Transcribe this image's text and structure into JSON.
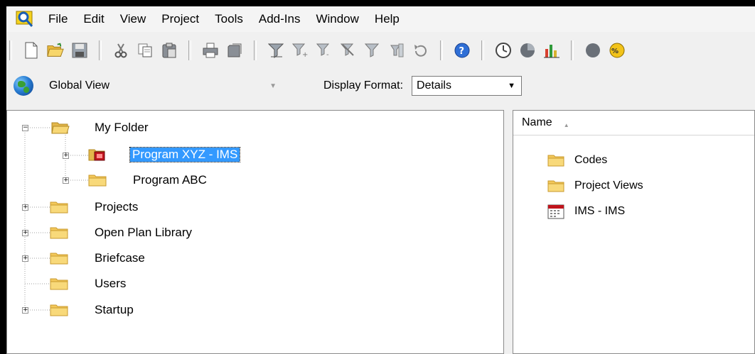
{
  "menu": [
    "File",
    "Edit",
    "View",
    "Project",
    "Tools",
    "Add-Ins",
    "Window",
    "Help"
  ],
  "view_bar": {
    "view_combo": "Global View",
    "display_format_label": "Display Format:",
    "display_format_value": "Details"
  },
  "tree": [
    {
      "label": "My Folder",
      "expanded": true
    },
    {
      "label": "Program XYZ - IMS",
      "selected": true
    },
    {
      "label": "Program ABC"
    },
    {
      "label": "Projects"
    },
    {
      "label": "Open Plan Library"
    },
    {
      "label": "Briefcase"
    },
    {
      "label": "Users"
    },
    {
      "label": "Startup"
    }
  ],
  "list": {
    "column": "Name",
    "items": [
      "Codes",
      "Project Views",
      "IMS - IMS"
    ]
  },
  "colors": {
    "selection": "#3399ff",
    "folder": "#f3c85a",
    "folder_dark": "#c99a2e"
  }
}
